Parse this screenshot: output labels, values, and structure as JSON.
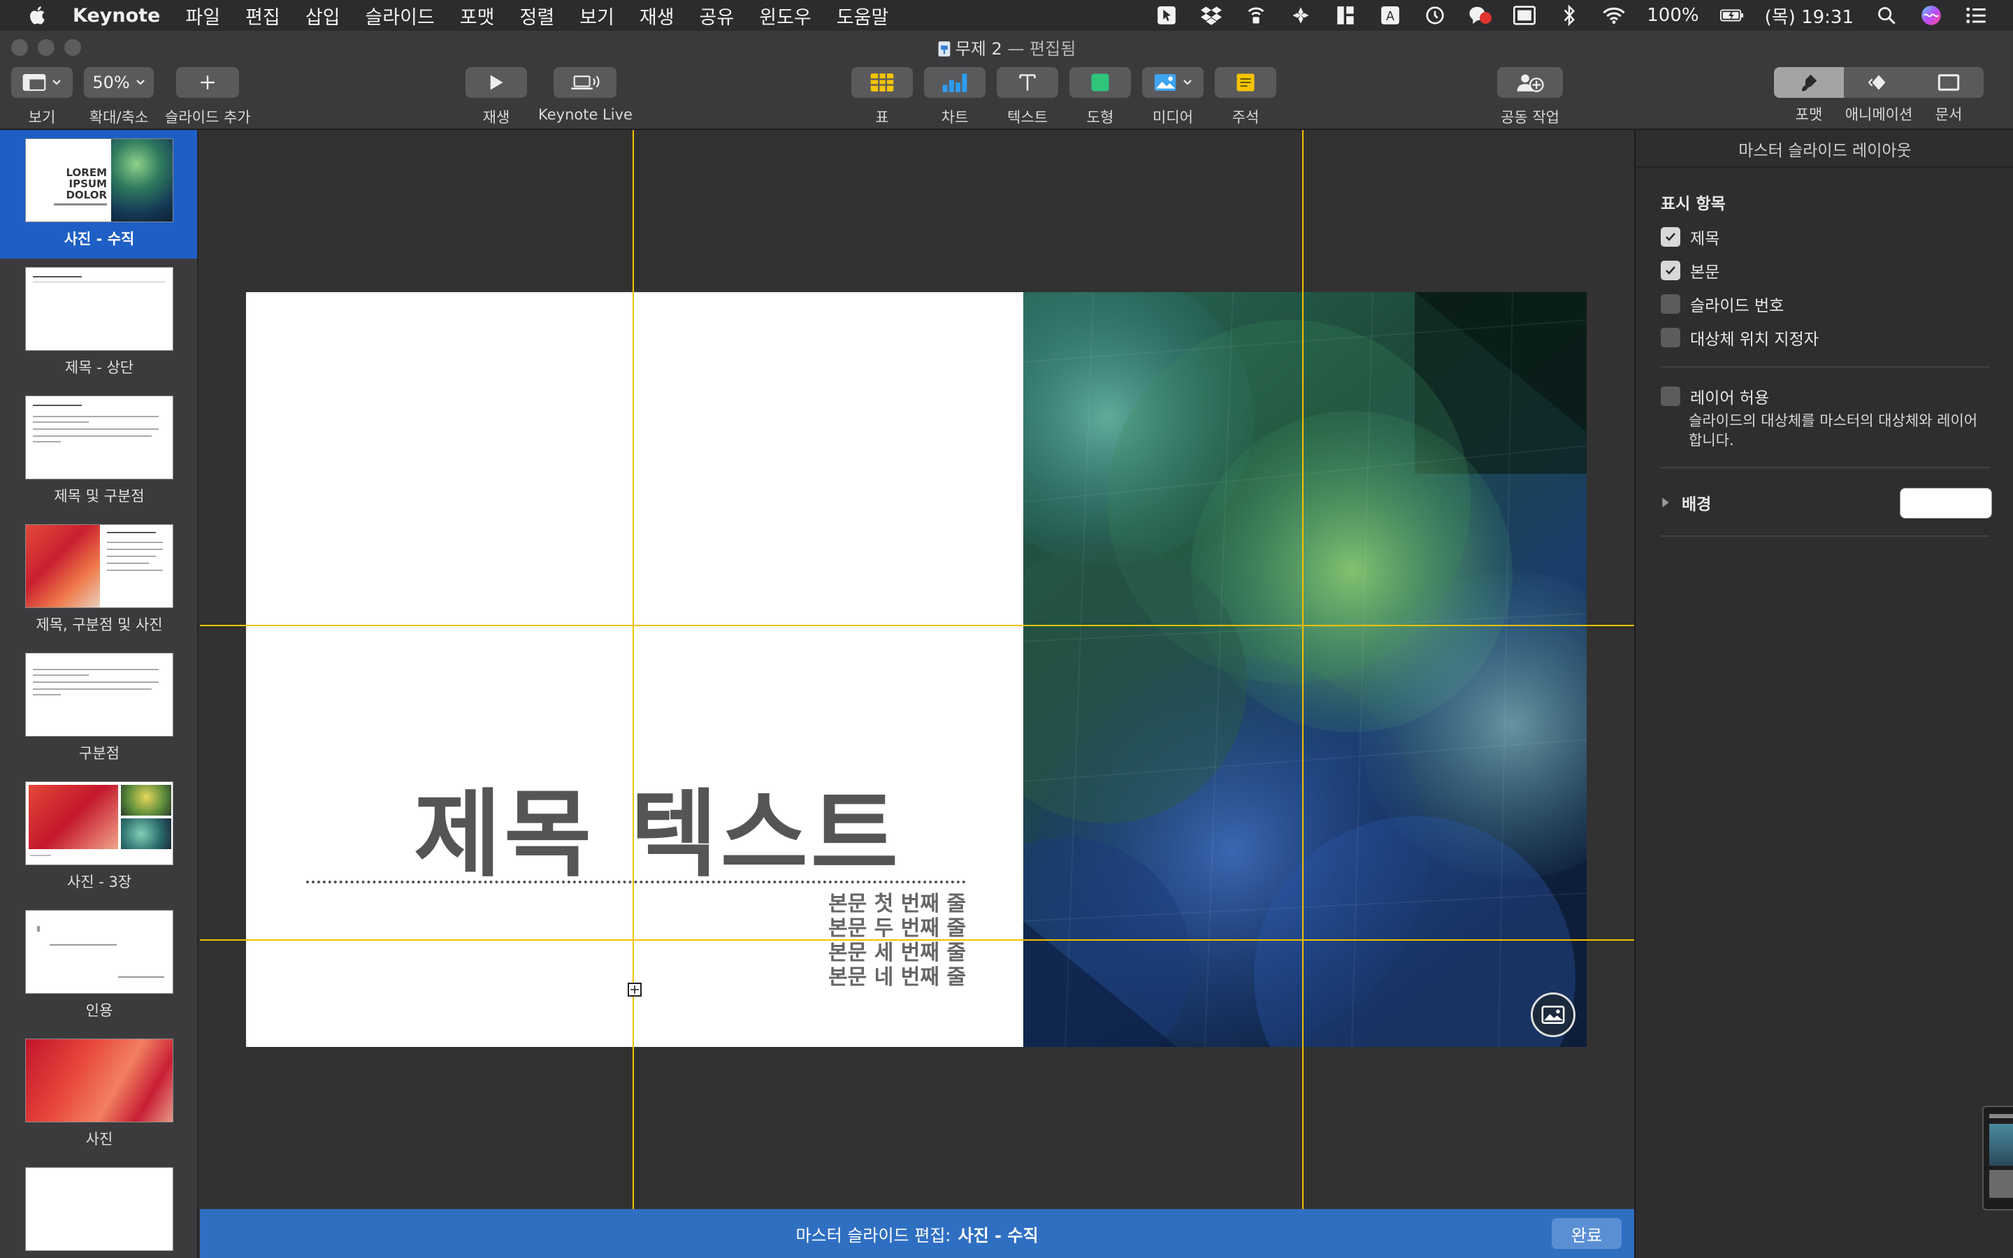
{
  "menubar": {
    "app_name": "Keynote",
    "items": [
      "파일",
      "편집",
      "삽입",
      "슬라이드",
      "포맷",
      "정렬",
      "보기",
      "재생",
      "공유",
      "윈도우",
      "도움말"
    ],
    "battery": "100%",
    "clock": "(목) 19:31"
  },
  "window": {
    "title": "무제 2",
    "status": " — 편집됨"
  },
  "toolbar": {
    "view_label": "보기",
    "zoom_value": "50%",
    "zoom_label": "확대/축소",
    "add_slide_label": "슬라이드 추가",
    "play_label": "재생",
    "keynote_live_label": "Keynote Live",
    "table_label": "표",
    "chart_label": "차트",
    "text_label": "텍스트",
    "shape_label": "도형",
    "media_label": "미디어",
    "comment_label": "주석",
    "collaborate_label": "공동 작업",
    "format_label": "포맷",
    "animate_label": "애니메이션",
    "document_label": "문서"
  },
  "navigator": {
    "items": [
      {
        "label": "사진 - 수직",
        "thumb_text": "LOREM IPSUM DOLOR"
      },
      {
        "label": "제목 - 상단"
      },
      {
        "label": "제목 및 구분점"
      },
      {
        "label": "제목, 구분점 및 사진"
      },
      {
        "label": "구분점"
      },
      {
        "label": "사진 - 3장"
      },
      {
        "label": "인용"
      },
      {
        "label": "사진"
      },
      {
        "label": ""
      }
    ]
  },
  "slide": {
    "title": "제목 텍스트",
    "body_lines": [
      "본문 첫 번째 줄",
      "본문 두 번째 줄",
      "본문 세 번째 줄",
      "본문 네 번째 줄"
    ]
  },
  "master_bar": {
    "prefix": "마스터 슬라이드 편집:",
    "master_name": "사진 - 수직",
    "done_label": "완료"
  },
  "inspector": {
    "title": "마스터 슬라이드 레이아웃",
    "appearance_heading": "표시 항목",
    "options": [
      {
        "label": "제목",
        "checked": true
      },
      {
        "label": "본문",
        "checked": true
      },
      {
        "label": "슬라이드 번호",
        "checked": false
      },
      {
        "label": "대상체 위치 지정자",
        "checked": false
      }
    ],
    "allow_layering_label": "레이어 허용",
    "allow_layering_desc": "슬라이드의 대상체를 마스터의 대상체와 레이어합니다.",
    "background_label": "배경",
    "colors": {
      "accent": "#2f6fc2",
      "selection": "#1e5fc5",
      "guide": "#f2c200"
    }
  }
}
